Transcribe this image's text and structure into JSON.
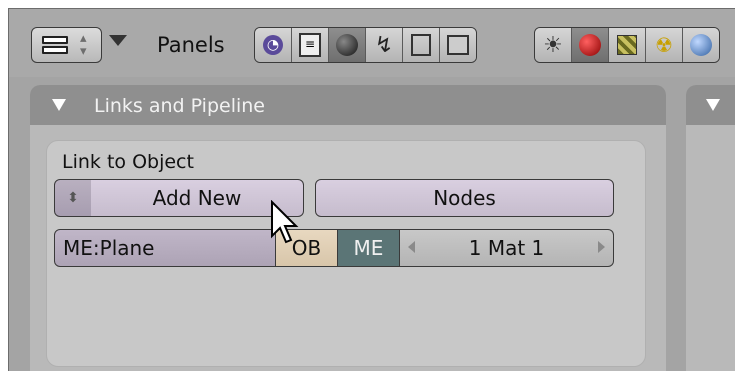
{
  "header": {
    "panels_label": "Panels",
    "context_icons": [
      {
        "name": "logic-icon",
        "glyph": "◔"
      },
      {
        "name": "script-icon",
        "glyph": "▤"
      },
      {
        "name": "shading-icon",
        "glyph": "●"
      },
      {
        "name": "object-icon",
        "glyph": "↯"
      },
      {
        "name": "editing-icon",
        "glyph": "▢"
      },
      {
        "name": "scene-icon",
        "glyph": "▣"
      }
    ],
    "shading_icons": [
      {
        "name": "lamp-icon",
        "glyph": "☀"
      },
      {
        "name": "material-icon",
        "glyph": "●"
      },
      {
        "name": "texture-icon",
        "glyph": "▦"
      },
      {
        "name": "radiosity-icon",
        "glyph": "☢"
      },
      {
        "name": "world-icon",
        "glyph": "◍"
      }
    ]
  },
  "panel": {
    "title": "Links and Pipeline",
    "link_to_object_label": "Link to Object",
    "add_new_label": "Add New",
    "nodes_label": "Nodes",
    "mesh_field": "ME:Plane",
    "ob_label": "OB",
    "me_label": "ME",
    "material_slot": "1 Mat 1"
  },
  "colors": {
    "me_active": "#5b7576",
    "button_lilac": "#d9cfe0",
    "ob_tan": "#e8d8c0"
  }
}
